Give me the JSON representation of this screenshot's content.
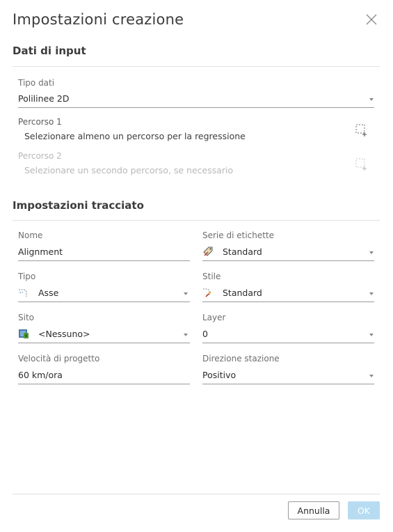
{
  "dialog": {
    "title": "Impostazioni creazione",
    "close_icon": "close-icon"
  },
  "input_section": {
    "heading": "Dati di input",
    "data_type": {
      "label": "Tipo dati",
      "value": "Polilinee 2D"
    },
    "path1": {
      "label": "Percorso 1",
      "description": "Selezionare almeno un percorso per la regressione",
      "icon": "select-path-icon"
    },
    "path2": {
      "label": "Percorso 2",
      "description": "Selezionare un secondo percorso, se necessario",
      "icon": "select-path-icon",
      "enabled": false
    }
  },
  "alignment_section": {
    "heading": "Impostazioni tracciato",
    "name": {
      "label": "Nome",
      "value": "Alignment"
    },
    "label_set": {
      "label": "Serie di etichette",
      "value": "Standard",
      "icon": "label-set-icon"
    },
    "type": {
      "label": "Tipo",
      "value": "Asse",
      "icon": "centerline-icon"
    },
    "style": {
      "label": "Stile",
      "value": "Standard",
      "icon": "alignment-style-icon"
    },
    "site": {
      "label": "Sito",
      "value": "<Nessuno>",
      "icon": "site-icon"
    },
    "layer": {
      "label": "Layer",
      "value": "0"
    },
    "design_speed": {
      "label": "Velocità di progetto",
      "value": "60 km/ora"
    },
    "station_direction": {
      "label": "Direzione stazione",
      "value": "Positivo"
    }
  },
  "footer": {
    "cancel_label": "Annulla",
    "ok_label": "OK"
  },
  "colors": {
    "ok_disabled_bg": "#b7dcf2",
    "text": "#3c3c3c",
    "disabled_text": "#b8b8b8"
  }
}
